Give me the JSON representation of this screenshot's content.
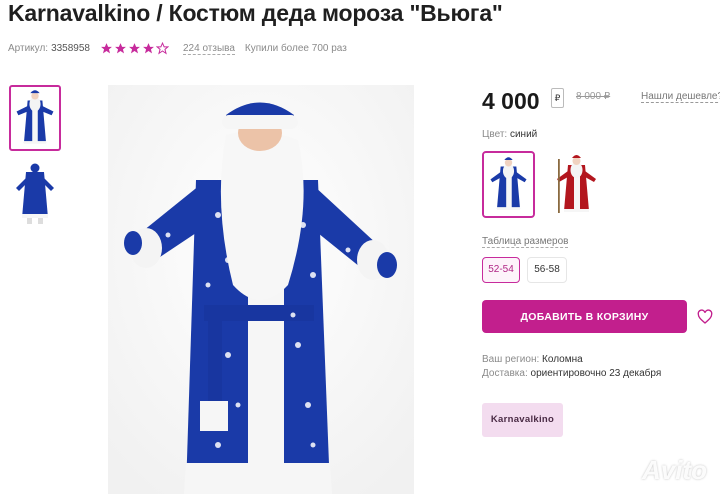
{
  "product": {
    "title": "Karnavalkino / Костюм деда мороза \"Вьюга\"",
    "sku_label": "Артикул:",
    "sku_value": "3358958",
    "rating": 4,
    "rating_max": 5,
    "reviews": "224 отзыва",
    "bought": "Купили более 700 раз"
  },
  "gallery": {
    "thumbs": [
      {
        "icon": "santa-blue-front",
        "active": true
      },
      {
        "icon": "santa-blue-back",
        "active": false
      }
    ]
  },
  "price": {
    "current": "4 000",
    "currency_box": "₽",
    "old": "8 000 ₽",
    "cheaper_link": "Нашли дешевле?"
  },
  "color": {
    "label": "Цвет:",
    "value": "синий",
    "options": [
      {
        "icon": "santa-blue",
        "active": true
      },
      {
        "icon": "santa-red",
        "active": false
      }
    ]
  },
  "sizes": {
    "table_link": "Таблица размеров",
    "options": [
      "52-54",
      "56-58"
    ],
    "selected": "52-54"
  },
  "cart": {
    "add_label": "ДОБАВИТЬ В КОРЗИНУ",
    "favorite_icon": "heart-icon"
  },
  "delivery": {
    "region_label": "Ваш регион:",
    "region_value": "Коломна",
    "delivery_label": "Доставка:",
    "delivery_value": "ориентировочно 23 декабря"
  },
  "brand": {
    "name": "Karnavalkino"
  },
  "watermark": "Avito",
  "colors": {
    "accent": "#c21f8d",
    "star": "#c72b9c",
    "costume_blue": "#1a3aa8",
    "costume_red": "#b3161e"
  }
}
